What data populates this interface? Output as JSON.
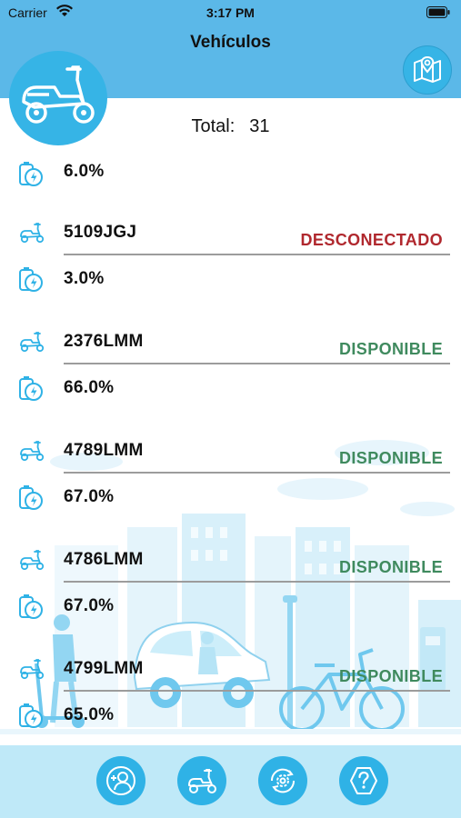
{
  "status_bar": {
    "carrier": "Carrier",
    "time": "3:17 PM"
  },
  "nav": {
    "title": "Vehículos",
    "map_icon": "map-icon",
    "logo_icon": "scooter-icon"
  },
  "total": {
    "label": "Total:",
    "value": "31"
  },
  "vehicles_partial": {
    "battery": "6.0%"
  },
  "vehicles": [
    {
      "plate": "5109JGJ",
      "status": "DESCONECTADO",
      "status_color": "#b0282e",
      "battery": "3.0%"
    },
    {
      "plate": "2376LMM",
      "status": "DISPONIBLE",
      "status_color": "#3f8a5e",
      "battery": "66.0%"
    },
    {
      "plate": "4789LMM",
      "status": "DISPONIBLE",
      "status_color": "#3f8a5e",
      "battery": "67.0%"
    },
    {
      "plate": "4786LMM",
      "status": "DISPONIBLE",
      "status_color": "#3f8a5e",
      "battery": "67.0%"
    },
    {
      "plate": "4799LMM",
      "status": "DISPONIBLE",
      "status_color": "#3f8a5e",
      "battery": "65.0%"
    }
  ],
  "tab_bar": {
    "icons": [
      "user-add-icon",
      "scooter-icon",
      "gear-refresh-icon",
      "help-icon"
    ]
  },
  "colors": {
    "header": "#5bb8e8",
    "accent": "#2fb2e6",
    "tab_bar": "#bfe9f8"
  }
}
